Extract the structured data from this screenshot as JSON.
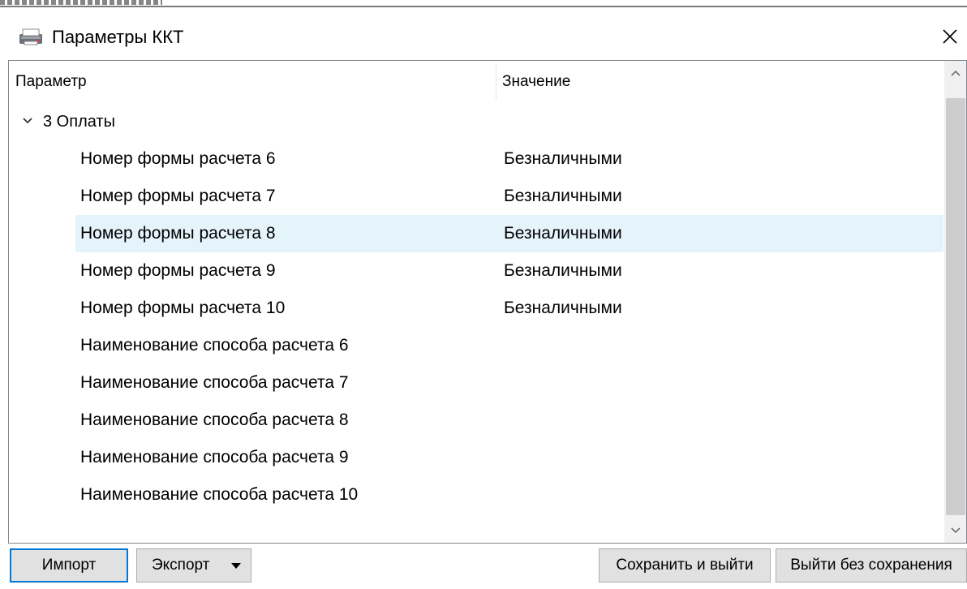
{
  "window": {
    "title": "Параметры ККТ",
    "icon": "printer-icon"
  },
  "grid": {
    "columns": {
      "param": "Параметр",
      "value": "Значение"
    },
    "group": {
      "label": "3 Оплаты",
      "expanded": true
    },
    "rows": [
      {
        "name": "Номер формы расчета 6",
        "value": "Безналичными"
      },
      {
        "name": "Номер формы расчета 7",
        "value": "Безналичными"
      },
      {
        "name": "Номер формы расчета 8",
        "value": "Безналичными",
        "selected": true
      },
      {
        "name": "Номер формы расчета 9",
        "value": "Безналичными"
      },
      {
        "name": "Номер формы расчета 10",
        "value": "Безналичными"
      },
      {
        "name": "Наименование способа расчета 6",
        "value": ""
      },
      {
        "name": "Наименование способа расчета 7",
        "value": ""
      },
      {
        "name": "Наименование способа расчета 8",
        "value": ""
      },
      {
        "name": "Наименование способа расчета 9",
        "value": ""
      },
      {
        "name": "Наименование способа расчета 10",
        "value": ""
      }
    ]
  },
  "buttons": {
    "import": "Импорт",
    "export": "Экспорт",
    "save_exit": "Сохранить и выйти",
    "exit_no_save": "Выйти без сохранения"
  },
  "colors": {
    "selection": "#e5f3fb",
    "focus_border": "#0078d7",
    "button_bg": "#e1e1e1"
  }
}
